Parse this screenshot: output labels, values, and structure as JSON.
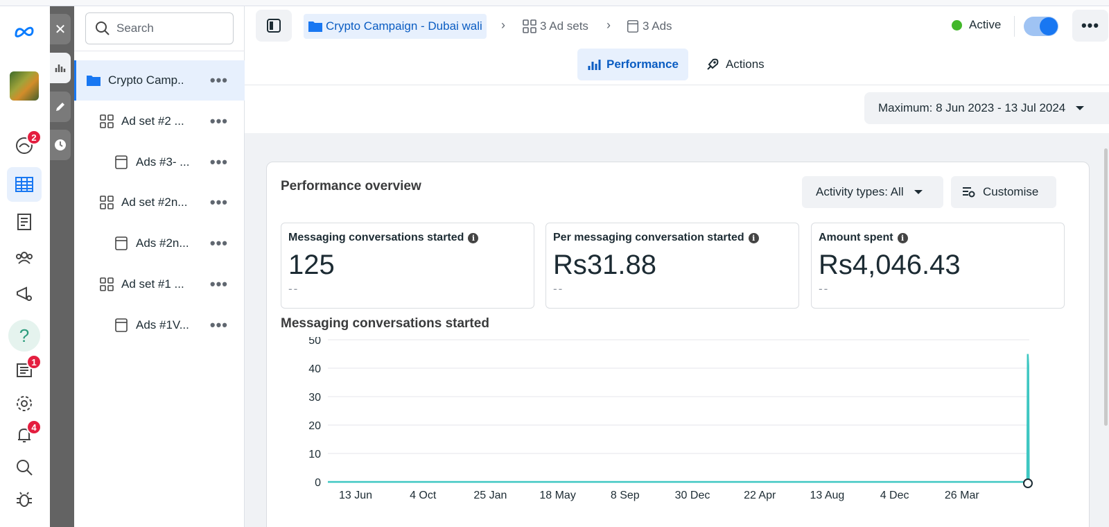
{
  "search": {
    "placeholder": "Search"
  },
  "rail": {
    "badges": {
      "activity": "2",
      "news": "1",
      "notifications": "4"
    },
    "help_glyph": "?"
  },
  "tree": {
    "items": [
      {
        "label": "Crypto Camp...",
        "type": "campaign",
        "level": 0,
        "selected": true
      },
      {
        "label": "Ad set #2 ...",
        "type": "adset",
        "level": 1
      },
      {
        "label": "Ads #3- ...",
        "type": "ad",
        "level": 2
      },
      {
        "label": "Ad set #2n...",
        "type": "adset",
        "level": 1
      },
      {
        "label": "Ads #2n...",
        "type": "ad",
        "level": 2
      },
      {
        "label": "Ad set #1 ...",
        "type": "adset",
        "level": 1
      },
      {
        "label": "Ads #1V...",
        "type": "ad",
        "level": 2
      }
    ]
  },
  "breadcrumb": {
    "campaign": "Crypto Campaign - Dubai wali",
    "adsets": "3 Ad sets",
    "ads": "3 Ads"
  },
  "status": {
    "label": "Active",
    "color": "#42b72a"
  },
  "tabs": {
    "performance": "Performance",
    "actions": "Actions"
  },
  "date_range": "Maximum: 8 Jun 2023 - 13 Jul 2024",
  "overview": {
    "title": "Performance overview",
    "activity_filter": "Activity types: All",
    "customise": "Customise",
    "metrics": [
      {
        "label": "Messaging conversations started",
        "value": "125",
        "change": "--"
      },
      {
        "label": "Per messaging conversation started",
        "value": "Rs31.88",
        "change": "--"
      },
      {
        "label": "Amount spent",
        "value": "Rs4,046.43",
        "change": "--"
      }
    ]
  },
  "chart_data": {
    "type": "line",
    "title": "Messaging conversations started",
    "categories": [
      "13 Jun",
      "4 Oct",
      "25 Jan",
      "18 May",
      "8 Sep",
      "30 Dec",
      "22 Apr",
      "13 Aug",
      "4 Dec",
      "26 Mar"
    ],
    "ylim": [
      0,
      50
    ],
    "yticks": [
      0,
      10,
      20,
      30,
      40,
      50
    ],
    "series": [
      {
        "values": [
          0,
          0,
          0,
          0,
          0,
          0,
          0,
          0,
          0,
          0,
          45,
          41,
          0
        ],
        "color": "#3ec7c2"
      }
    ],
    "grid": true
  },
  "colors": {
    "accent": "#1877f2",
    "badge": "#e41e3f"
  }
}
